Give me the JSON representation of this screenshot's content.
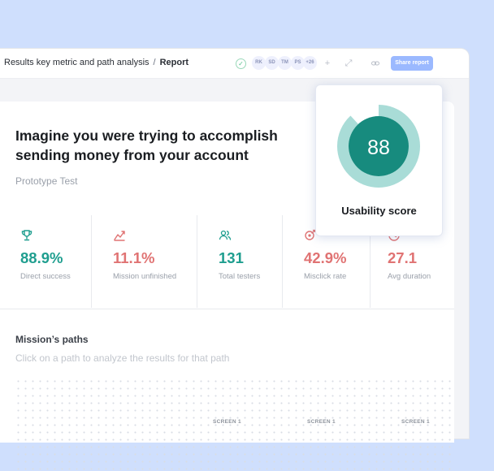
{
  "breadcrumb": {
    "parent": "Results key metric and path analysis",
    "separator": "/",
    "current": "Report"
  },
  "toolbar": {
    "avatars": [
      "RK",
      "SD",
      "TM",
      "PS",
      "+26"
    ],
    "share_label": "Share report",
    "icons": [
      "check-circle-icon",
      "plus-icon",
      "expand-icon",
      "link-icon"
    ]
  },
  "task": {
    "title": "Imagine you were trying to accomplish sending money from your account",
    "type": "Prototype Test"
  },
  "metrics": [
    {
      "icon": "trophy-icon",
      "value": "88.9%",
      "label": "Direct success",
      "color": "#1f9e8f"
    },
    {
      "icon": "mission-icon",
      "value": "11.1%",
      "label": "Mission unfinished",
      "color": "#e07373"
    },
    {
      "icon": "users-icon",
      "value": "131",
      "label": "Total testers",
      "color": "#1f9e8f"
    },
    {
      "icon": "target-icon",
      "value": "42.9%",
      "label": "Misclick rate",
      "color": "#e07373"
    },
    {
      "icon": "clock-icon",
      "value": "27.1",
      "label": "Avg duration",
      "color": "#e07373"
    }
  ],
  "paths": {
    "title": "Mission’s paths",
    "hint": "Click on a path to analyze the results for that path",
    "screens": [
      "SCREEN 1",
      "SCREEN 1",
      "SCREEN 1"
    ]
  },
  "usability": {
    "score": "88",
    "score_fraction": 0.88,
    "label": "Usability score",
    "ring_color": "#a9dcd7",
    "core_color": "#178b7e"
  }
}
